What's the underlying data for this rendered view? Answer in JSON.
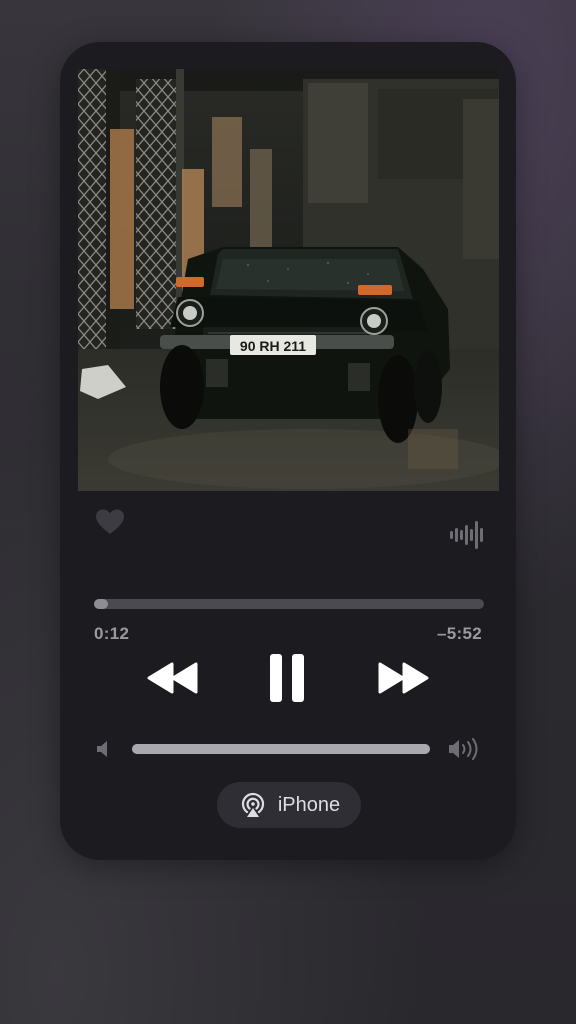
{
  "player": {
    "elapsed": "0:12",
    "remaining": "–5:52",
    "progress_fraction": 0.03,
    "volume_fraction": 1.0,
    "liked": false,
    "state": "playing"
  },
  "artwork": {
    "plate_text": "90 RH 211"
  },
  "route": {
    "label": "iPhone",
    "icon": "airplay-audio-icon"
  },
  "icons": {
    "heart": "heart-icon",
    "waveform": "waveform-icon",
    "rewind": "rewind-icon",
    "pause": "pause-icon",
    "forward": "fast-forward-icon",
    "volume_min": "speaker-low-icon",
    "volume_max": "speaker-high-icon"
  },
  "colors": {
    "card": "#1c1b20",
    "track": "#4b4a50",
    "fill": "#8e8d93",
    "controls": "#ffffff",
    "text_muted": "#9a999f"
  }
}
